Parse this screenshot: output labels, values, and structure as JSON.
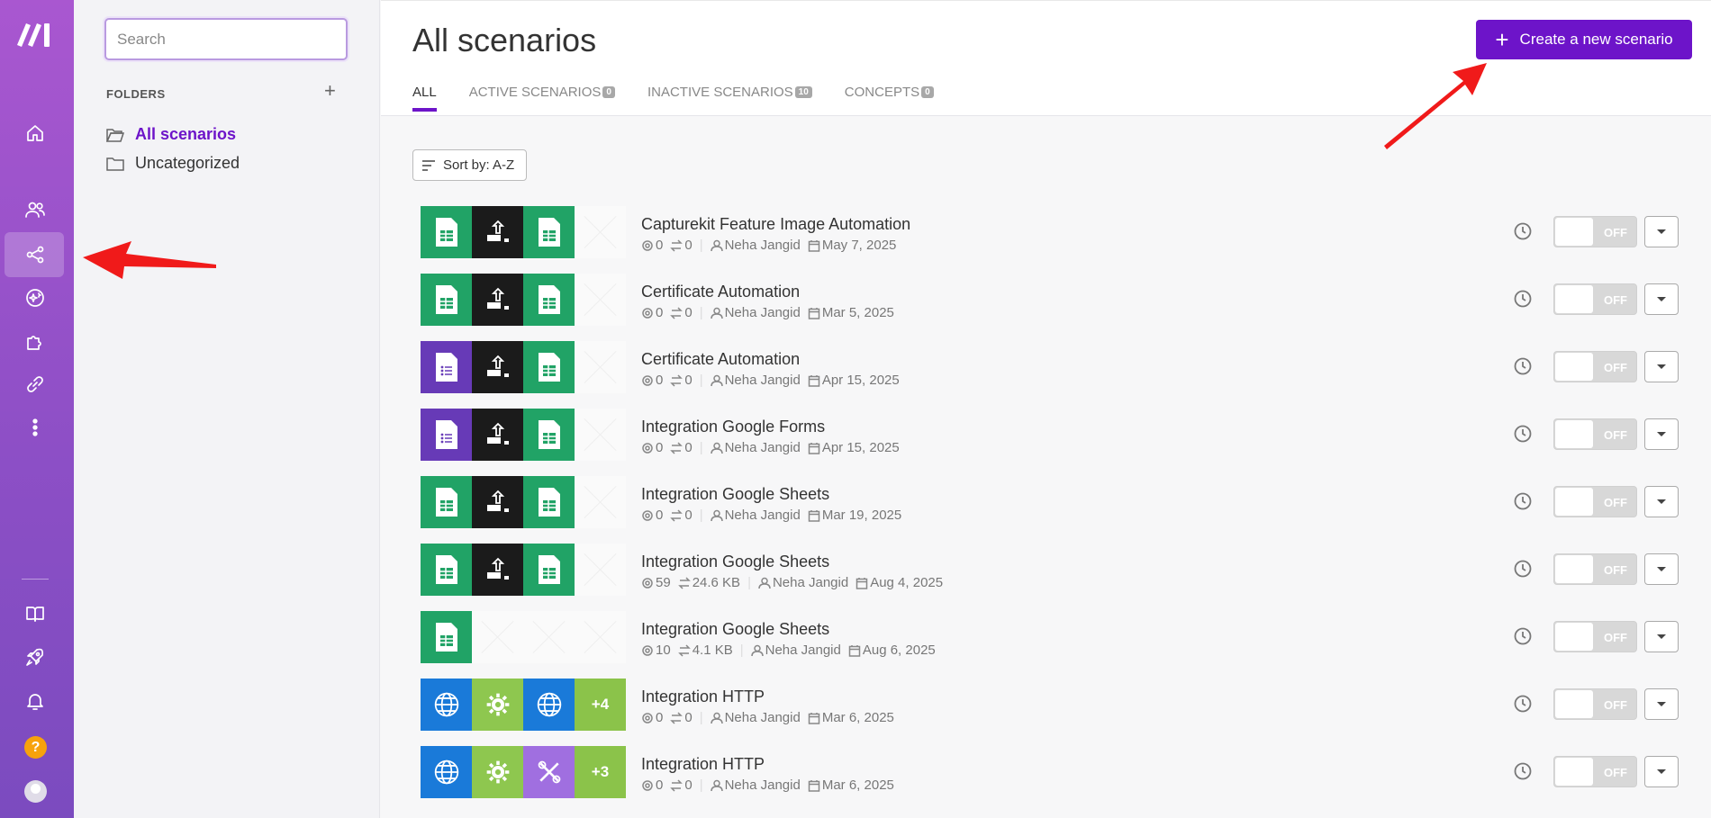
{
  "rail": {
    "items": [
      "home-icon",
      "team-icon",
      "scenarios-icon",
      "ai-icon",
      "apps-icon",
      "connections-icon",
      "more-icon",
      "docs-icon",
      "launch-icon",
      "bell-icon",
      "help-icon",
      "avatar"
    ],
    "help_label": "?"
  },
  "folders": {
    "search_placeholder": "Search",
    "title": "FOLDERS",
    "add_label": "+",
    "items": [
      {
        "label": "All scenarios",
        "active": true
      },
      {
        "label": "Uncategorized",
        "active": false
      }
    ]
  },
  "header": {
    "title": "All scenarios",
    "create_label": "Create a new scenario",
    "create_icon": "+",
    "tabs": [
      {
        "label": "ALL",
        "count": null,
        "active": true
      },
      {
        "label": "ACTIVE SCENARIOS",
        "count": "0",
        "active": false
      },
      {
        "label": "INACTIVE SCENARIOS",
        "count": "10",
        "active": false
      },
      {
        "label": "CONCEPTS",
        "count": "0",
        "active": false
      }
    ]
  },
  "sort_label": "Sort by: A-Z",
  "toggle_label": "OFF",
  "scenarios": [
    {
      "name": "Capturekit Feature Image Automation",
      "ops": "0",
      "transfer": "0",
      "owner": "Neha Jangid",
      "date": "May 7, 2025",
      "modules": [
        "sheets",
        "dark",
        "sheets",
        "empty"
      ]
    },
    {
      "name": "Certificate Automation",
      "ops": "0",
      "transfer": "0",
      "owner": "Neha Jangid",
      "date": "Mar 5, 2025",
      "modules": [
        "sheets",
        "dark",
        "sheets",
        "empty"
      ]
    },
    {
      "name": "Certificate Automation",
      "ops": "0",
      "transfer": "0",
      "owner": "Neha Jangid",
      "date": "Apr 15, 2025",
      "modules": [
        "forms",
        "dark",
        "sheets",
        "empty"
      ]
    },
    {
      "name": "Integration Google Forms",
      "ops": "0",
      "transfer": "0",
      "owner": "Neha Jangid",
      "date": "Apr 15, 2025",
      "modules": [
        "forms",
        "dark",
        "sheets",
        "empty"
      ]
    },
    {
      "name": "Integration Google Sheets",
      "ops": "0",
      "transfer": "0",
      "owner": "Neha Jangid",
      "date": "Mar 19, 2025",
      "modules": [
        "sheets",
        "dark",
        "sheets",
        "empty"
      ]
    },
    {
      "name": "Integration Google Sheets",
      "ops": "59",
      "transfer": "24.6 KB",
      "owner": "Neha Jangid",
      "date": "Aug 4, 2025",
      "modules": [
        "sheets",
        "dark",
        "sheets",
        "empty"
      ]
    },
    {
      "name": "Integration Google Sheets",
      "ops": "10",
      "transfer": "4.1 KB",
      "owner": "Neha Jangid",
      "date": "Aug 6, 2025",
      "modules": [
        "sheets",
        "empty",
        "empty",
        "empty"
      ]
    },
    {
      "name": "Integration HTTP",
      "ops": "0",
      "transfer": "0",
      "owner": "Neha Jangid",
      "date": "Mar 6, 2025",
      "modules": [
        "http",
        "tools",
        "http",
        "more"
      ],
      "more": "+4"
    },
    {
      "name": "Integration HTTP",
      "ops": "0",
      "transfer": "0",
      "owner": "Neha Jangid",
      "date": "Mar 6, 2025",
      "modules": [
        "http",
        "tools",
        "flow",
        "more"
      ],
      "more": "+3"
    }
  ],
  "colors": {
    "accent": "#6d14c9",
    "sheets": "#21a366",
    "forms": "#673ab7",
    "http": "#1a7ad9",
    "tools": "#8ec74f",
    "annotation_arrow": "#f01a1a"
  }
}
